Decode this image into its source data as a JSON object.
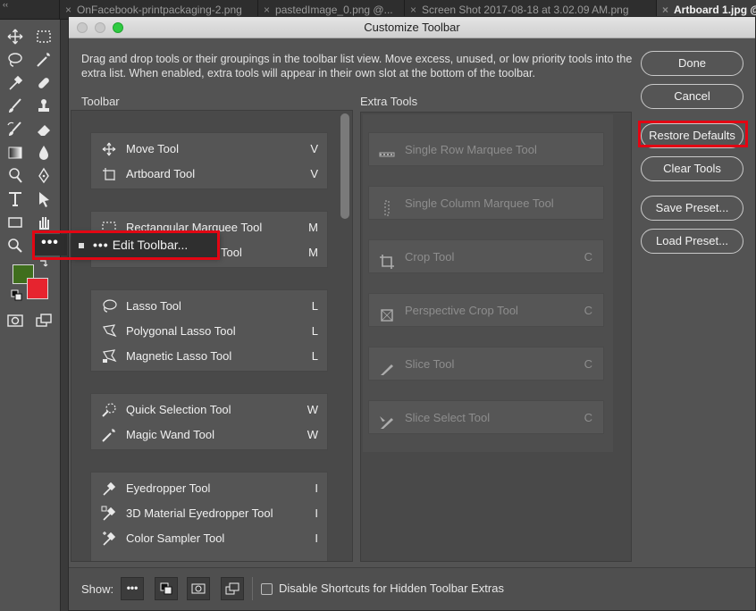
{
  "document_tabs": [
    {
      "label": "OnFacebook-printpackaging-2.png"
    },
    {
      "label": "pastedImage_0.png @..."
    },
    {
      "label": "Screen Shot 2017-08-18 at 3.02.09 AM.png"
    },
    {
      "label": "Artboard 1.jpg @"
    }
  ],
  "edit_toolbar": {
    "dots": "•••",
    "label": "Edit Toolbar..."
  },
  "dialog": {
    "title": "Customize Toolbar",
    "description": "Drag and drop tools or their groupings in the toolbar list view. Move excess, unused, or low priority tools into the extra list. When enabled, extra tools will appear in their own slot at the bottom of the toolbar.",
    "toolbar_label": "Toolbar",
    "extra_label": "Extra Tools",
    "groups": [
      {
        "items": [
          {
            "icon": "move-icon",
            "label": "Move Tool",
            "key": "V"
          },
          {
            "icon": "artboard-icon",
            "label": "Artboard Tool",
            "key": "V"
          }
        ]
      },
      {
        "items": [
          {
            "icon": "rect-marquee-icon",
            "label": "Rectangular Marquee Tool",
            "key": "M"
          },
          {
            "icon": "ellipse-marquee-icon",
            "label": "Elliptical Marquee Tool",
            "key": "M"
          }
        ]
      },
      {
        "items": [
          {
            "icon": "lasso-icon",
            "label": "Lasso Tool",
            "key": "L"
          },
          {
            "icon": "polygonal-lasso-icon",
            "label": "Polygonal Lasso Tool",
            "key": "L"
          },
          {
            "icon": "magnetic-lasso-icon",
            "label": "Magnetic Lasso Tool",
            "key": "L"
          }
        ]
      },
      {
        "items": [
          {
            "icon": "quick-selection-icon",
            "label": "Quick Selection Tool",
            "key": "W"
          },
          {
            "icon": "magic-wand-icon",
            "label": "Magic Wand Tool",
            "key": "W"
          }
        ]
      },
      {
        "items": [
          {
            "icon": "eyedropper-icon",
            "label": "Eyedropper Tool",
            "key": "I"
          },
          {
            "icon": "3d-eyedropper-icon",
            "label": "3D Material Eyedropper Tool",
            "key": "I"
          },
          {
            "icon": "color-sampler-icon",
            "label": "Color Sampler Tool",
            "key": "I"
          }
        ]
      }
    ],
    "extra_tools": [
      {
        "icon": "single-row-marquee-icon",
        "label": "Single Row Marquee Tool",
        "key": ""
      },
      {
        "icon": "single-column-marquee-icon",
        "label": "Single Column Marquee Tool",
        "key": ""
      },
      {
        "icon": "crop-icon",
        "label": "Crop Tool",
        "key": "C"
      },
      {
        "icon": "perspective-crop-icon",
        "label": "Perspective Crop Tool",
        "key": "C"
      },
      {
        "icon": "slice-icon",
        "label": "Slice Tool",
        "key": "C"
      },
      {
        "icon": "slice-select-icon",
        "label": "Slice Select Tool",
        "key": "C"
      }
    ],
    "buttons": {
      "done": "Done",
      "cancel": "Cancel",
      "restore": "Restore Defaults",
      "clear": "Clear Tools",
      "save_preset": "Save Preset...",
      "load_preset": "Load Preset..."
    },
    "footer": {
      "show_label": "Show:",
      "dots": "•••",
      "checkbox_label": "Disable Shortcuts for Hidden Toolbar Extras",
      "checkbox_checked": false
    }
  },
  "colors": {
    "foreground_swatch": "#3f6e1d",
    "background_swatch": "#e6242f",
    "highlight": "#e30613"
  }
}
